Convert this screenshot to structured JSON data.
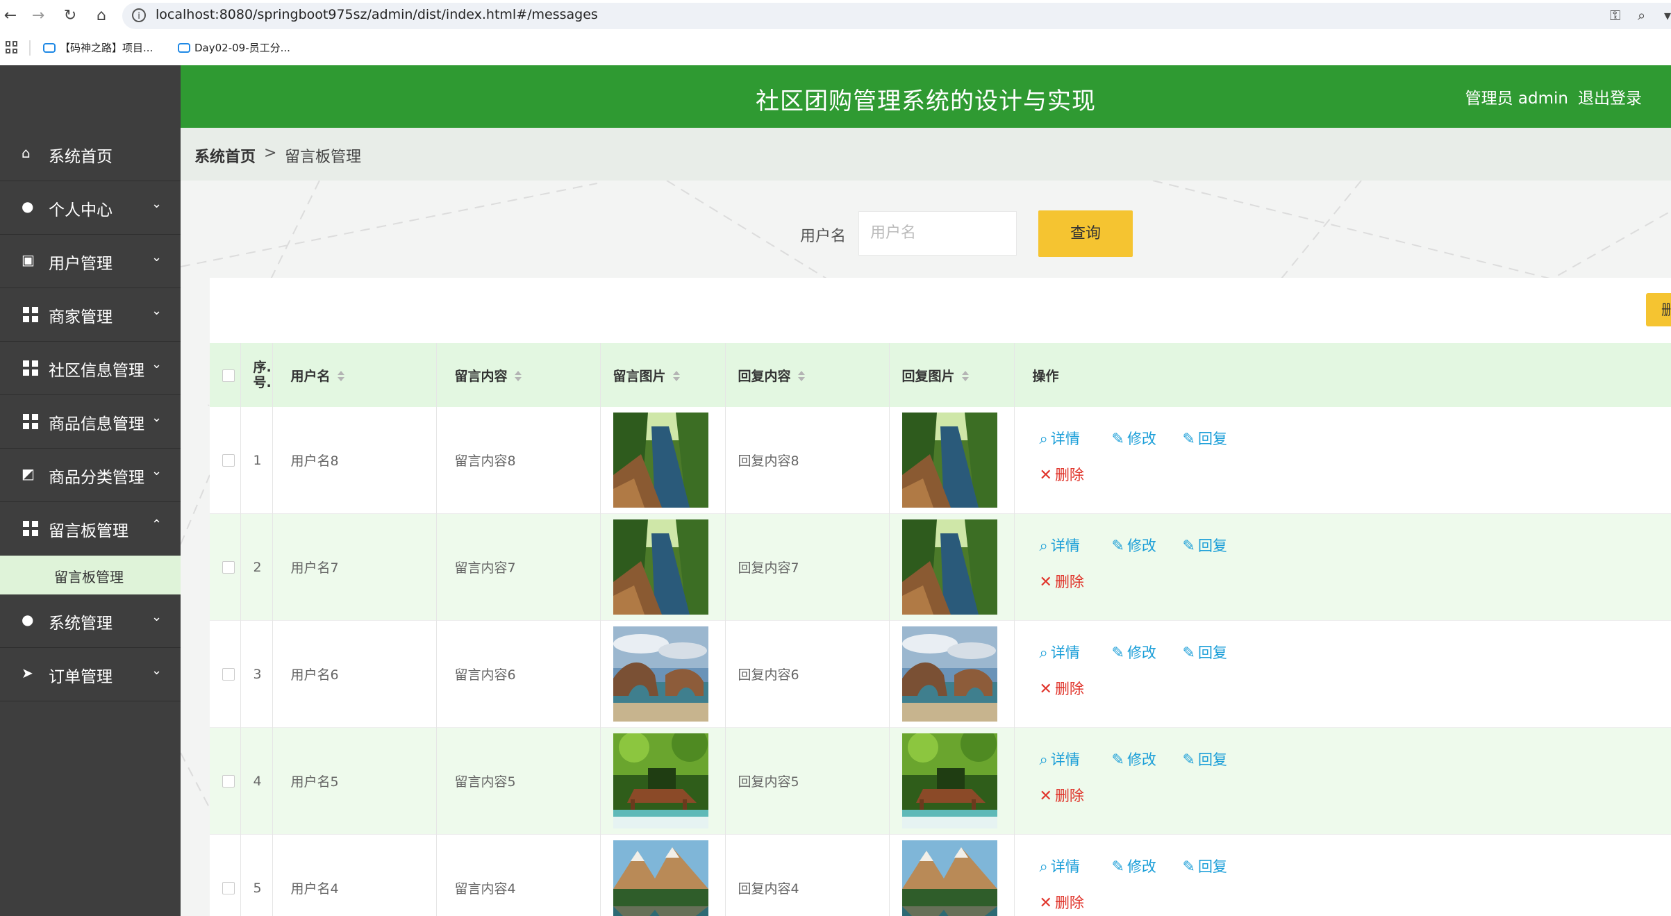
{
  "browser": {
    "url": "localhost:8080/springboot975sz/admin/dist/index.html#/messages",
    "bookmarks": [
      "【码神之路】项目...",
      "Day02-09-员工分..."
    ]
  },
  "header": {
    "title": "社区团购管理系统的设计与实现",
    "user": "管理员 admin",
    "logout": "退出登录",
    "color": "#2f9a32"
  },
  "sidebar": {
    "items": [
      {
        "label": "系统首页",
        "icon": "home-icon",
        "has_children": false
      },
      {
        "label": "个人中心",
        "icon": "user-icon",
        "has_children": true
      },
      {
        "label": "用户管理",
        "icon": "clipboard-icon",
        "has_children": true
      },
      {
        "label": "商家管理",
        "icon": "grid-icon",
        "has_children": true
      },
      {
        "label": "社区信息管理",
        "icon": "grid-icon",
        "has_children": true
      },
      {
        "label": "商品信息管理",
        "icon": "grid-icon",
        "has_children": true
      },
      {
        "label": "商品分类管理",
        "icon": "chart-icon",
        "has_children": true
      },
      {
        "label": "留言板管理",
        "icon": "grid-icon",
        "has_children": true,
        "expanded": true
      },
      {
        "label": "系统管理",
        "icon": "bulb-icon",
        "has_children": true
      },
      {
        "label": "订单管理",
        "icon": "send-icon",
        "has_children": true
      }
    ],
    "active_sub": "留言板管理"
  },
  "breadcrumb": {
    "home": "系统首页",
    "sep": ">",
    "current": "留言板管理"
  },
  "search": {
    "label": "用户名",
    "placeholder": "用户名",
    "button": "查询"
  },
  "toolbar": {
    "delete_label": "删"
  },
  "table": {
    "headers": {
      "index": "序.\n号.",
      "username": "用户名",
      "content": "留言内容",
      "image": "留言图片",
      "reply": "回复内容",
      "reply_image": "回复图片",
      "ops": "操作"
    },
    "rows": [
      {
        "index": "1",
        "username": "用户名8",
        "content": "留言内容8",
        "reply": "回复内容8",
        "image": "forest-river"
      },
      {
        "index": "2",
        "username": "用户名7",
        "content": "留言内容7",
        "reply": "回复内容7",
        "image": "forest-river"
      },
      {
        "index": "3",
        "username": "用户名6",
        "content": "留言内容6",
        "reply": "回复内容6",
        "image": "sea-arch"
      },
      {
        "index": "4",
        "username": "用户名5",
        "content": "留言内容5",
        "reply": "回复内容5",
        "image": "jungle-waterfall"
      },
      {
        "index": "5",
        "username": "用户名4",
        "content": "留言内容4",
        "reply": "回复内容4",
        "image": "mountain-lake"
      }
    ],
    "ops": {
      "detail": "详情",
      "edit": "修改",
      "reply": "回复",
      "delete": "删除"
    }
  }
}
